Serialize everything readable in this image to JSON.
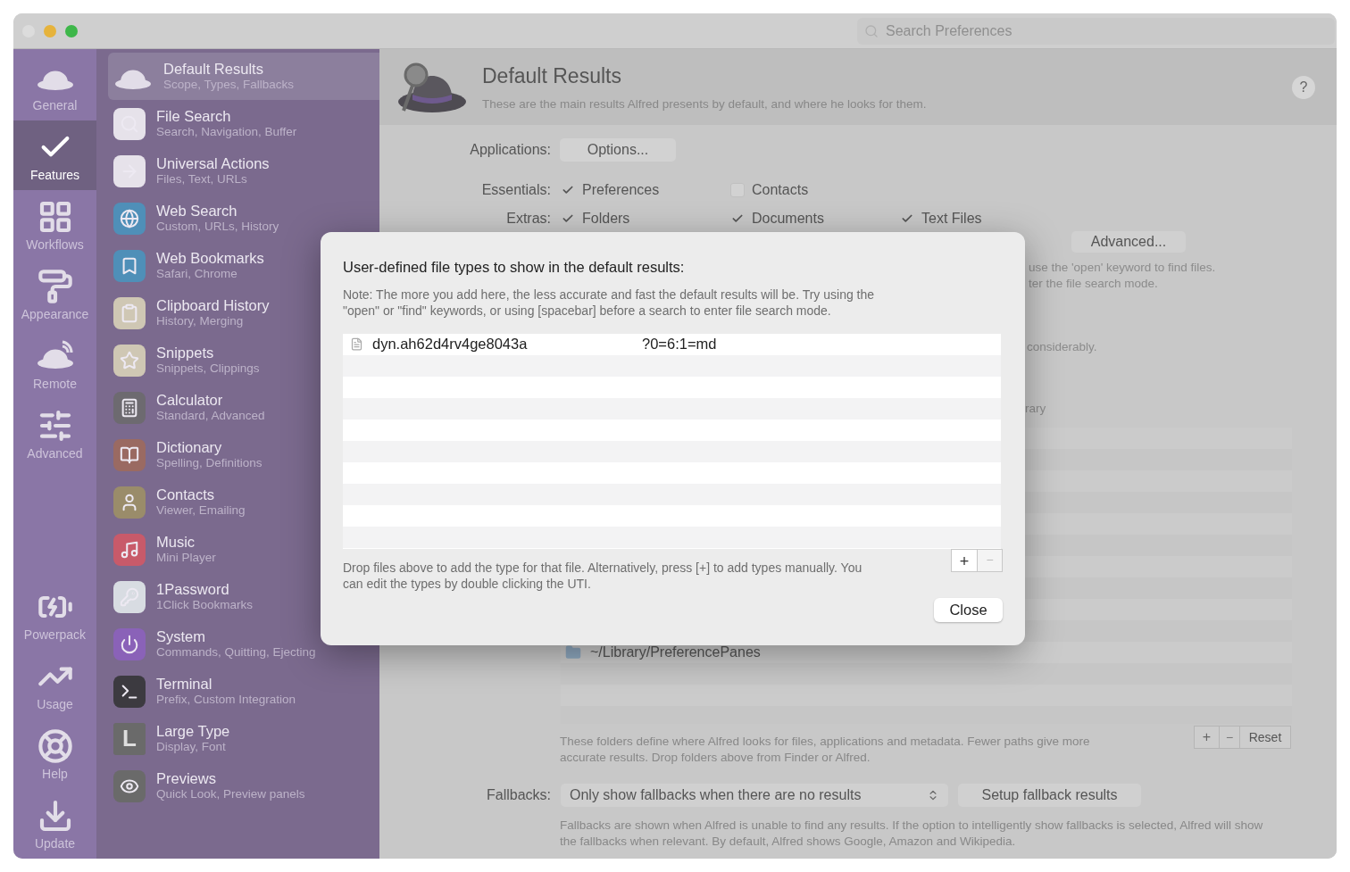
{
  "window": {
    "search": {
      "placeholder": "Search Preferences"
    }
  },
  "rail": [
    {
      "label": "General",
      "selected": false
    },
    {
      "label": "Features",
      "selected": true
    },
    {
      "label": "Workflows",
      "selected": false
    },
    {
      "label": "Appearance",
      "selected": false
    },
    {
      "label": "Remote",
      "selected": false
    },
    {
      "label": "Advanced",
      "selected": false
    },
    {
      "label": "Powerpack",
      "selected": false
    },
    {
      "label": "Usage",
      "selected": false
    },
    {
      "label": "Help",
      "selected": false
    },
    {
      "label": "Update",
      "selected": false
    }
  ],
  "features": [
    {
      "title": "Default Results",
      "subtitle": "Scope, Types, Fallbacks",
      "selected": true
    },
    {
      "title": "File Search",
      "subtitle": "Search, Navigation, Buffer",
      "selected": false
    },
    {
      "title": "Universal Actions",
      "subtitle": "Files, Text, URLs",
      "selected": false
    },
    {
      "title": "Web Search",
      "subtitle": "Custom, URLs, History",
      "selected": false
    },
    {
      "title": "Web Bookmarks",
      "subtitle": "Safari, Chrome",
      "selected": false
    },
    {
      "title": "Clipboard History",
      "subtitle": "History, Merging",
      "selected": false
    },
    {
      "title": "Snippets",
      "subtitle": "Snippets, Clippings",
      "selected": false
    },
    {
      "title": "Calculator",
      "subtitle": "Standard, Advanced",
      "selected": false
    },
    {
      "title": "Dictionary",
      "subtitle": "Spelling, Definitions",
      "selected": false
    },
    {
      "title": "Contacts",
      "subtitle": "Viewer, Emailing",
      "selected": false
    },
    {
      "title": "Music",
      "subtitle": "Mini Player",
      "selected": false
    },
    {
      "title": "1Password",
      "subtitle": "1Click Bookmarks",
      "selected": false
    },
    {
      "title": "System",
      "subtitle": "Commands, Quitting, Ejecting",
      "selected": false
    },
    {
      "title": "Terminal",
      "subtitle": "Prefix, Custom Integration",
      "selected": false
    },
    {
      "title": "Large Type",
      "subtitle": "Display, Font",
      "selected": false,
      "icon_letter": "L"
    },
    {
      "title": "Previews",
      "subtitle": "Quick Look, Preview panels",
      "selected": false
    }
  ],
  "header": {
    "title": "Default Results",
    "subtitle": "These are the main results Alfred presents by default, and where he looks for them.",
    "help": "?"
  },
  "applications": {
    "label": "Applications:",
    "button": "Options..."
  },
  "essentials": {
    "label": "Essentials:",
    "options": [
      {
        "label": "Preferences",
        "checked": true
      },
      {
        "label": "Contacts",
        "checked": false
      }
    ]
  },
  "extras": {
    "label": "Extras:",
    "options": [
      {
        "label": "Folders",
        "checked": true
      },
      {
        "label": "Documents",
        "checked": true
      },
      {
        "label": "Text Files",
        "checked": true
      }
    ]
  },
  "advanced_button": "Advanced...",
  "partial_notes": [
    "use the 'open' keyword to find files.",
    "ter the file search mode."
  ],
  "partial_note_2": "considerably.",
  "partial_note_3": "rary",
  "search_scope": {
    "folders": [
      "~/Library/PreferencePanes"
    ],
    "add": "+",
    "remove": "−",
    "reset": "Reset",
    "description": "These folders define where Alfred looks for files, applications and metadata. Fewer paths give more accurate results. Drop folders above from Finder or Alfred."
  },
  "fallbacks": {
    "label": "Fallbacks:",
    "value": "Only show fallbacks when there are no results",
    "button": "Setup fallback results",
    "description": "Fallbacks are shown when Alfred is unable to find any results. If the option to intelligently show fallbacks is selected, Alfred will show the fallbacks when relevant. By default, Alfred shows Google, Amazon and Wikipedia."
  },
  "dialog": {
    "title": "User-defined file types to show in the default results:",
    "note": "Note: The more you add here, the less accurate and fast the default results will be. Try using the \"open\" or \"find\" keywords, or using [spacebar] before a search to enter file search mode.",
    "types": [
      {
        "uti": "dyn.ah62d4rv4ge8043a",
        "extension": "?0=6:1=md"
      }
    ],
    "add": "+",
    "remove": "−",
    "hint": "Drop files above to add the type for that file. Alternatively, press [+] to add types manually. You can edit the types by double clicking the UTI.",
    "close": "Close"
  }
}
